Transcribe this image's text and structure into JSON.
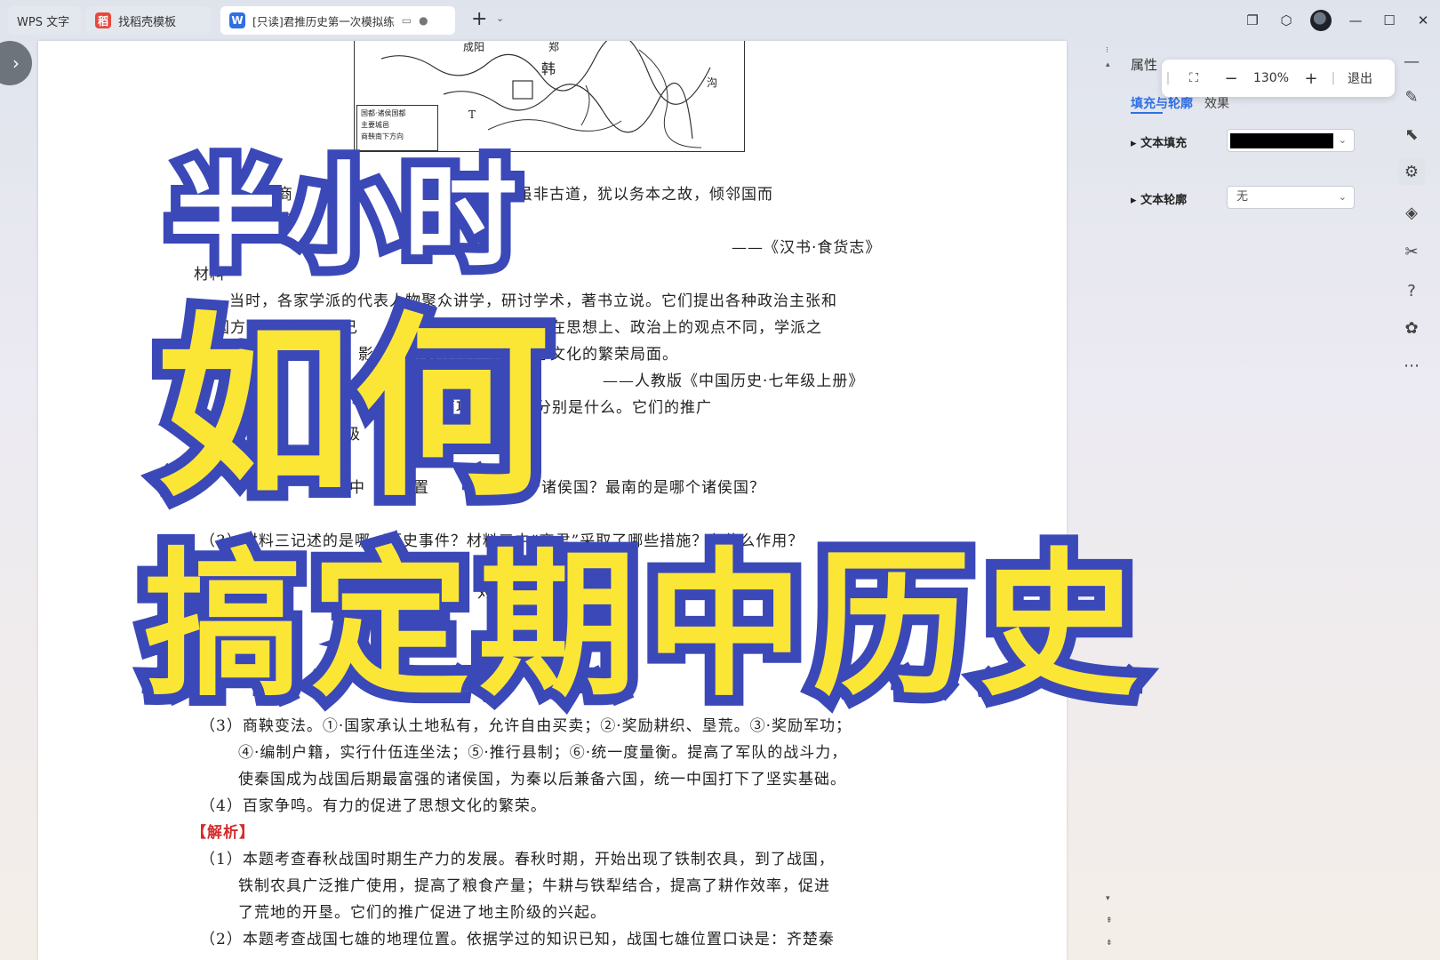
{
  "tabs": [
    {
      "label": "WPS 文字"
    },
    {
      "label": "找稻壳模板",
      "icon": "docer-icon"
    },
    {
      "label": "[只读]君推历史第一次模拟练",
      "icon": "word-doc-icon"
    }
  ],
  "toolbar": {
    "add_tab": "+",
    "zoom_out": "−",
    "zoom_level": "130%",
    "zoom_in": "+",
    "exit_label": "退出"
  },
  "map": {
    "labels": [
      "成阳",
      "郑",
      "韩",
      "沟",
      "T"
    ],
    "legend": [
      "国都·诸侯国都",
      "主要城邑",
      "商鞅南下方向"
    ]
  },
  "document": {
    "lines": [
      {
        "text": "材料三",
        "kind": "heading"
      },
      {
        "text": "孝公用商　　不井田　　　　　战之赏。虽非古道，犹以务本之故，倾邻国而"
      },
      {
        "text": "国"
      },
      {
        "text": "——《汉书·食货志》"
      },
      {
        "text": "材料"
      },
      {
        "text": "当时，各家学派的代表人物聚众讲学，研讨学术，著书立说。它们提出各种政治主张和"
      },
      {
        "text": "国方略，希望用自己　　解决社会问题。各学派在思想上、政治上的观点不同，学派之"
      },
      {
        "text": "相　　　　　　　　影响，取长补短，呈现思想文化的繁荣局面。"
      },
      {
        "text": "——人教版《中国历史·七年级上册》"
      },
      {
        "text": "　　　　　　　　　　展水平的两项重要技术分别是什么。它们的推广"
      },
      {
        "text": "级"
      },
      {
        "text": "中　　位置　　　　　　个诸侯国？最南的是哪个诸侯国？"
      },
      {
        "text": "（3）材料三记述的是哪一历史事件？材料三中“商君”采取了哪些措施？有什么作用？"
      },
      {
        "text": "四　　　　　　　对　　　　　　　　　　　　　　　　向？"
      },
      {
        "text": "地　"
      },
      {
        "text": "（3）商鞅变法。①·国家承认土地私有，允许自由买卖；②·奖励耕织、垦荒。③·奖励军功；"
      },
      {
        "text": "④·编制户籍，实行什伍连坐法；⑤·推行县制；⑥·统一度量衡。提高了军队的战斗力，"
      },
      {
        "text": "使秦国成为战国后期最富强的诸侯国，为秦以后兼备六国，统一中国打下了坚实基础。"
      },
      {
        "text": "（4）百家争鸣。有力的促进了思想文化的繁荣。"
      },
      {
        "text": "【解析】",
        "kind": "red"
      },
      {
        "text": "（1）本题考查春秋战国时期生产力的发展。春秋时期，开始出现了铁制农具，到了战国，"
      },
      {
        "text": "铁制农具广泛推广使用，提高了粮食产量；牛耕与铁犁结合，提高了耕作效率，促进"
      },
      {
        "text": "了荒地的开垦。它们的推广促进了地主阶级的兴起。"
      },
      {
        "text": "（2）本题考查战国七雄的地理位置。依据学过的知识已知，战国七雄位置口诀是：齐楚秦"
      }
    ]
  },
  "panel": {
    "title": "属性",
    "tab_fill": "填充与轮廓",
    "tab_effect": "效果",
    "fill_label": "文本填充",
    "fill_color": "#000000",
    "outline_label": "文本轮廓",
    "outline_value": "无"
  },
  "headline": {
    "line1": "半小时",
    "line2": "如何",
    "line3": "搞定期中历史",
    "colors": {
      "fill": "#fbe636",
      "line1_fill": "#ffffff",
      "stroke": "#3b48b8"
    }
  },
  "side_icons": [
    "minimize-panel-icon",
    "pen-icon",
    "select-icon",
    "properties-icon",
    "shape-icon",
    "tools-icon",
    "help-icon",
    "plugin-icon",
    "more-icon"
  ]
}
